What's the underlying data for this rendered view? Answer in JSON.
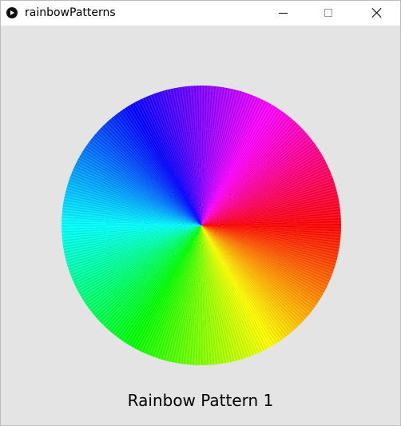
{
  "window": {
    "title": "rainbowPatterns",
    "app_icon": "play-icon",
    "controls": {
      "minimize_icon": "minimize-icon",
      "maximize_icon": "maximize-icon",
      "close_icon": "close-icon"
    }
  },
  "canvas": {
    "background": "#e4e4e4",
    "caption": "Rainbow Pattern 1",
    "wheel_colors": [
      "#ff0000",
      "#ffff00",
      "#00ff00",
      "#00ffff",
      "#0000ff",
      "#ff00ff"
    ]
  }
}
